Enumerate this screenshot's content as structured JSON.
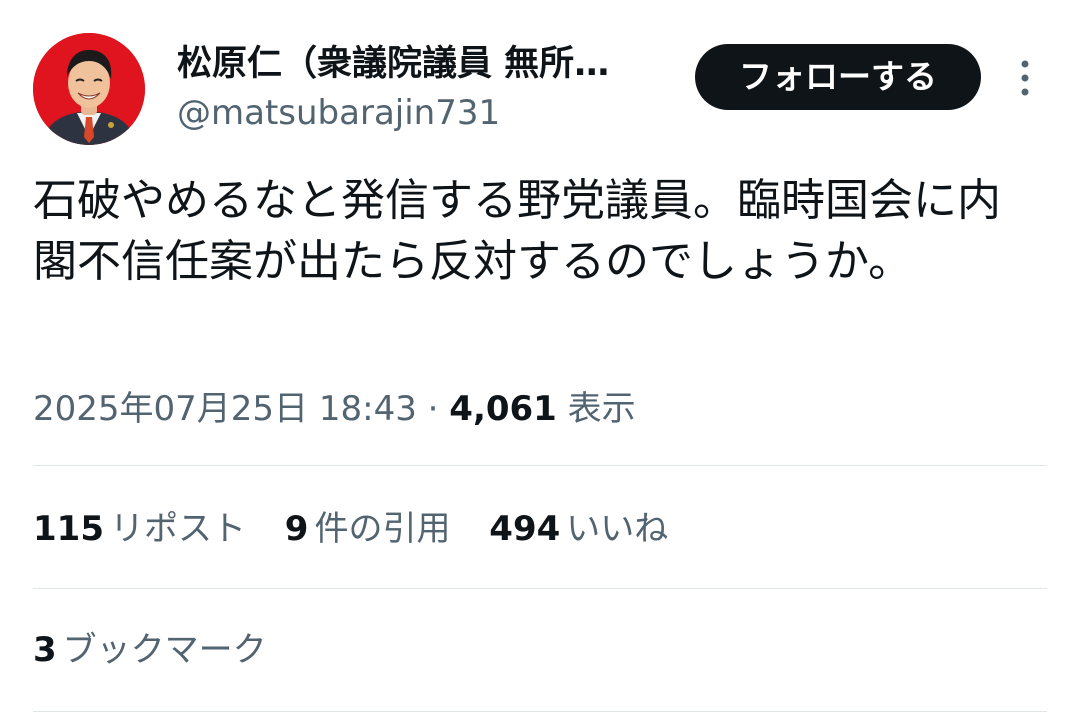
{
  "author": {
    "name": "松原仁（衆議院議員 無所属）",
    "handle": "@matsubarajin731"
  },
  "follow_button": {
    "label": "フォローする"
  },
  "more_menu": {
    "icon": "more-vertical-icon"
  },
  "tweet": {
    "text": "石破やめるなと発信する野党議員。臨時国会に内閣不信任案が出たら反対するのでしょうか。"
  },
  "meta": {
    "timestamp": "2025年07月25日 18:43",
    "separator": "·",
    "views_count": "4,061",
    "views_label": "表示"
  },
  "stats": {
    "reposts": {
      "count": "115",
      "label": "リポスト"
    },
    "quotes": {
      "count": "9",
      "label": "件の引用"
    },
    "likes": {
      "count": "494",
      "label": "いいね"
    }
  },
  "bookmarks": {
    "count": "3",
    "label": "ブックマーク"
  },
  "colors": {
    "avatar_bg": "#e0141e",
    "text_primary": "#0f1419",
    "text_secondary": "#536471",
    "divider": "#e1e6ea",
    "button_bg": "#0f1419"
  }
}
